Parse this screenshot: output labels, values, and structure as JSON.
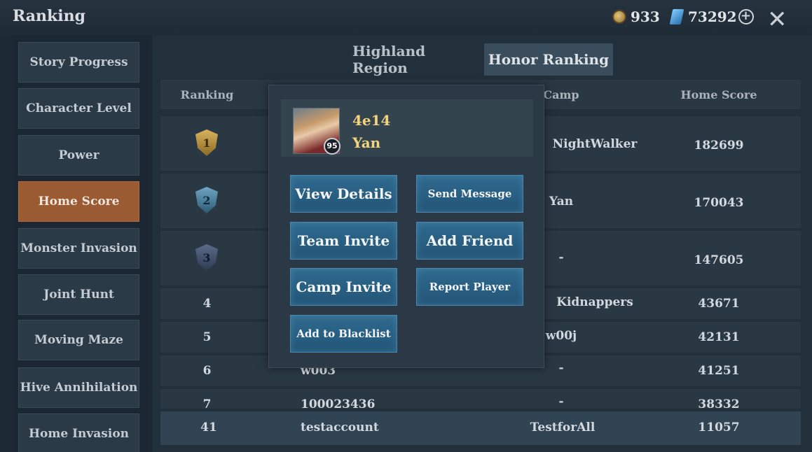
{
  "header": {
    "title": "Ranking",
    "coins": "933",
    "gems": "73292"
  },
  "icons": {
    "coin": "coin-icon",
    "gem": "gem-icon",
    "plus": "plus-icon",
    "close": "close-icon",
    "medals": [
      "medal-1-icon",
      "medal-2-icon",
      "medal-3-icon"
    ]
  },
  "sidebar": {
    "items": [
      {
        "label": "Story Progress"
      },
      {
        "label": "Character Level"
      },
      {
        "label": "Power"
      },
      {
        "label": "Home Score",
        "active": true
      },
      {
        "label": "Monster Invasion"
      },
      {
        "label": "Joint Hunt"
      },
      {
        "label": "Moving Maze"
      },
      {
        "label": "Hive Annihilation"
      },
      {
        "label": "Home Invasion"
      }
    ]
  },
  "tabs": [
    {
      "label": "Highland Region"
    },
    {
      "label": "Honor Ranking",
      "active": true
    }
  ],
  "table": {
    "headers": [
      "Ranking",
      "Camp",
      "Home Score"
    ],
    "rows": [
      {
        "rank": "1",
        "name": "",
        "camp": "NightWalker",
        "score": "182699"
      },
      {
        "rank": "2",
        "name": "",
        "camp": "Yan",
        "score": "170043"
      },
      {
        "rank": "3",
        "name": "",
        "camp": "-",
        "score": "147605"
      },
      {
        "rank": "4",
        "name": "",
        "camp": "Kidnappers",
        "score": "43671"
      },
      {
        "rank": "5",
        "name": "",
        "camp": "w00j",
        "score": "42131"
      },
      {
        "rank": "6",
        "name": "w003",
        "camp": "-",
        "score": "41251"
      },
      {
        "rank": "7",
        "name": "100023436",
        "camp": "-",
        "score": "38332"
      }
    ],
    "my_row": {
      "rank": "41",
      "name": "testaccount",
      "camp": "TestforAll",
      "score": "11057"
    }
  },
  "popup": {
    "player_id": "4e14",
    "player_name": "Yan",
    "level": "95",
    "buttons": {
      "view_details": "View Details",
      "send_message": "Send Message",
      "team_invite": "Team Invite",
      "add_friend": "Add Friend",
      "camp_invite": "Camp Invite",
      "report_player": "Report Player",
      "add_blacklist": "Add to Blacklist"
    }
  },
  "colors": {
    "accent_active": "#9a5a32",
    "gold_text": "#f3d47d",
    "button_blue": "#2f6a8f"
  }
}
